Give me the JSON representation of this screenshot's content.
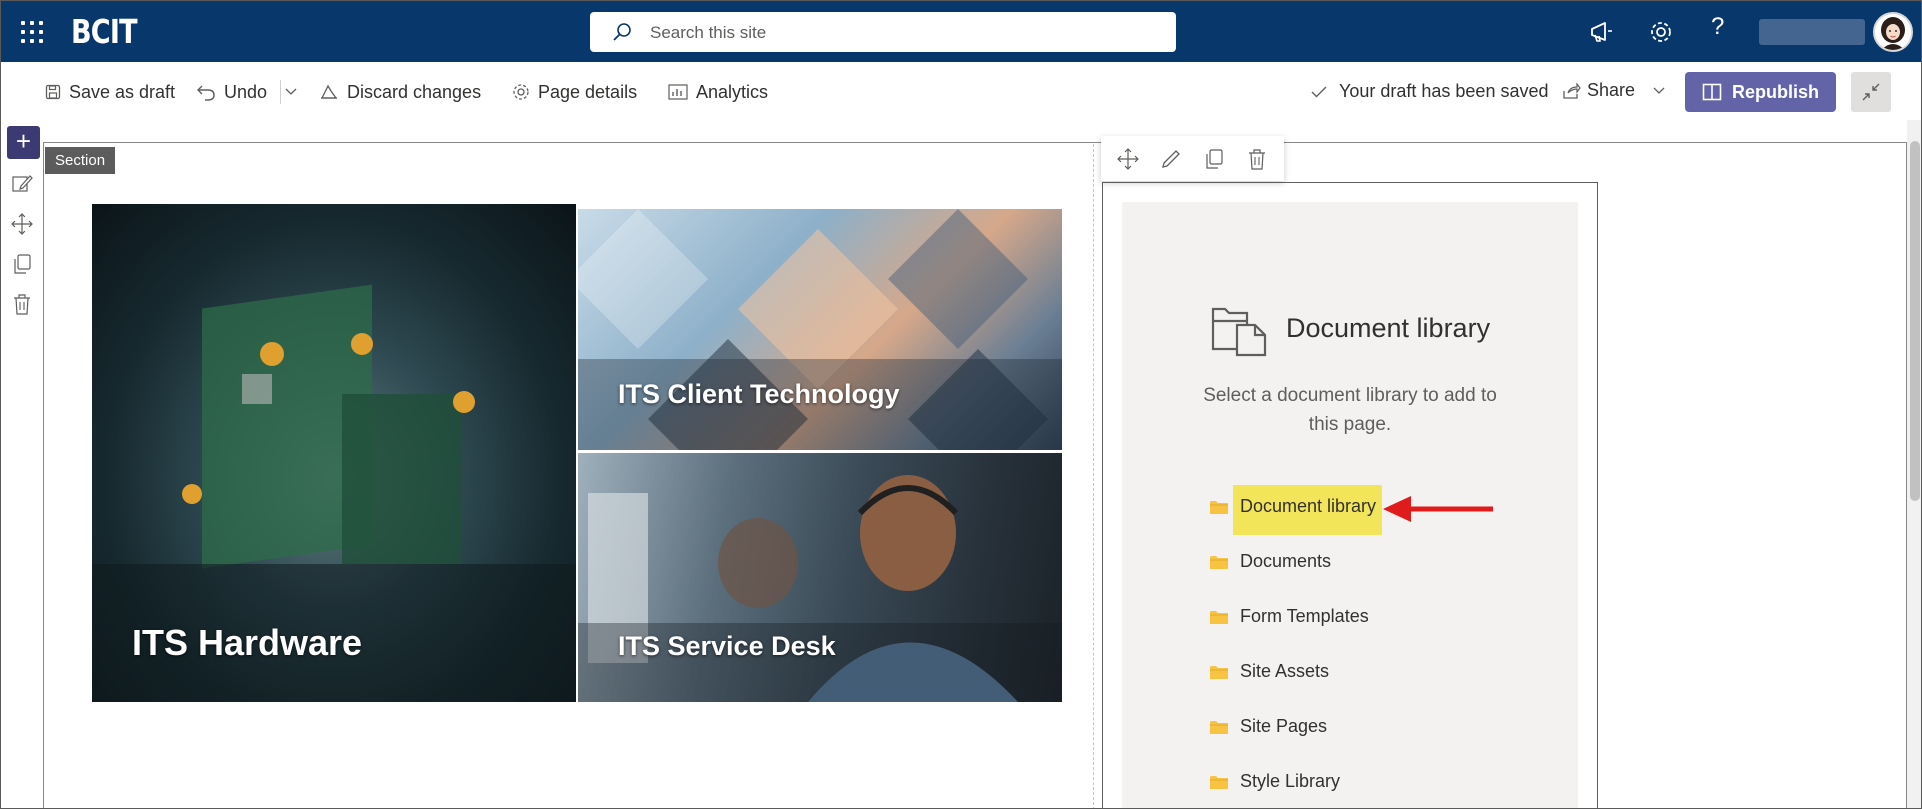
{
  "suite": {
    "brand": "BCIT",
    "search_placeholder": "Search this site",
    "help_glyph": "?"
  },
  "commands": {
    "save_draft": "Save as draft",
    "undo": "Undo",
    "discard": "Discard changes",
    "page_details": "Page details",
    "analytics": "Analytics",
    "status": "Your draft has been saved",
    "share": "Share",
    "republish": "Republish"
  },
  "canvas": {
    "section_tag": "Section"
  },
  "hero": {
    "tiles": [
      {
        "label": "ITS Hardware"
      },
      {
        "label": "ITS Client Technology"
      },
      {
        "label": "ITS Service Desk"
      }
    ]
  },
  "doc_library": {
    "title": "Document library",
    "description": "Select a document library to add to this page.",
    "items": [
      {
        "label": "Document library",
        "highlighted": true
      },
      {
        "label": "Documents"
      },
      {
        "label": "Form Templates"
      },
      {
        "label": "Site Assets"
      },
      {
        "label": "Site Pages"
      },
      {
        "label": "Style Library"
      }
    ]
  },
  "colors": {
    "suite_bar": "#07376b",
    "republish": "#6264a7",
    "highlight": "#f2e55a",
    "annotation_arrow": "#e01b1b",
    "folder": "#f6c343"
  }
}
